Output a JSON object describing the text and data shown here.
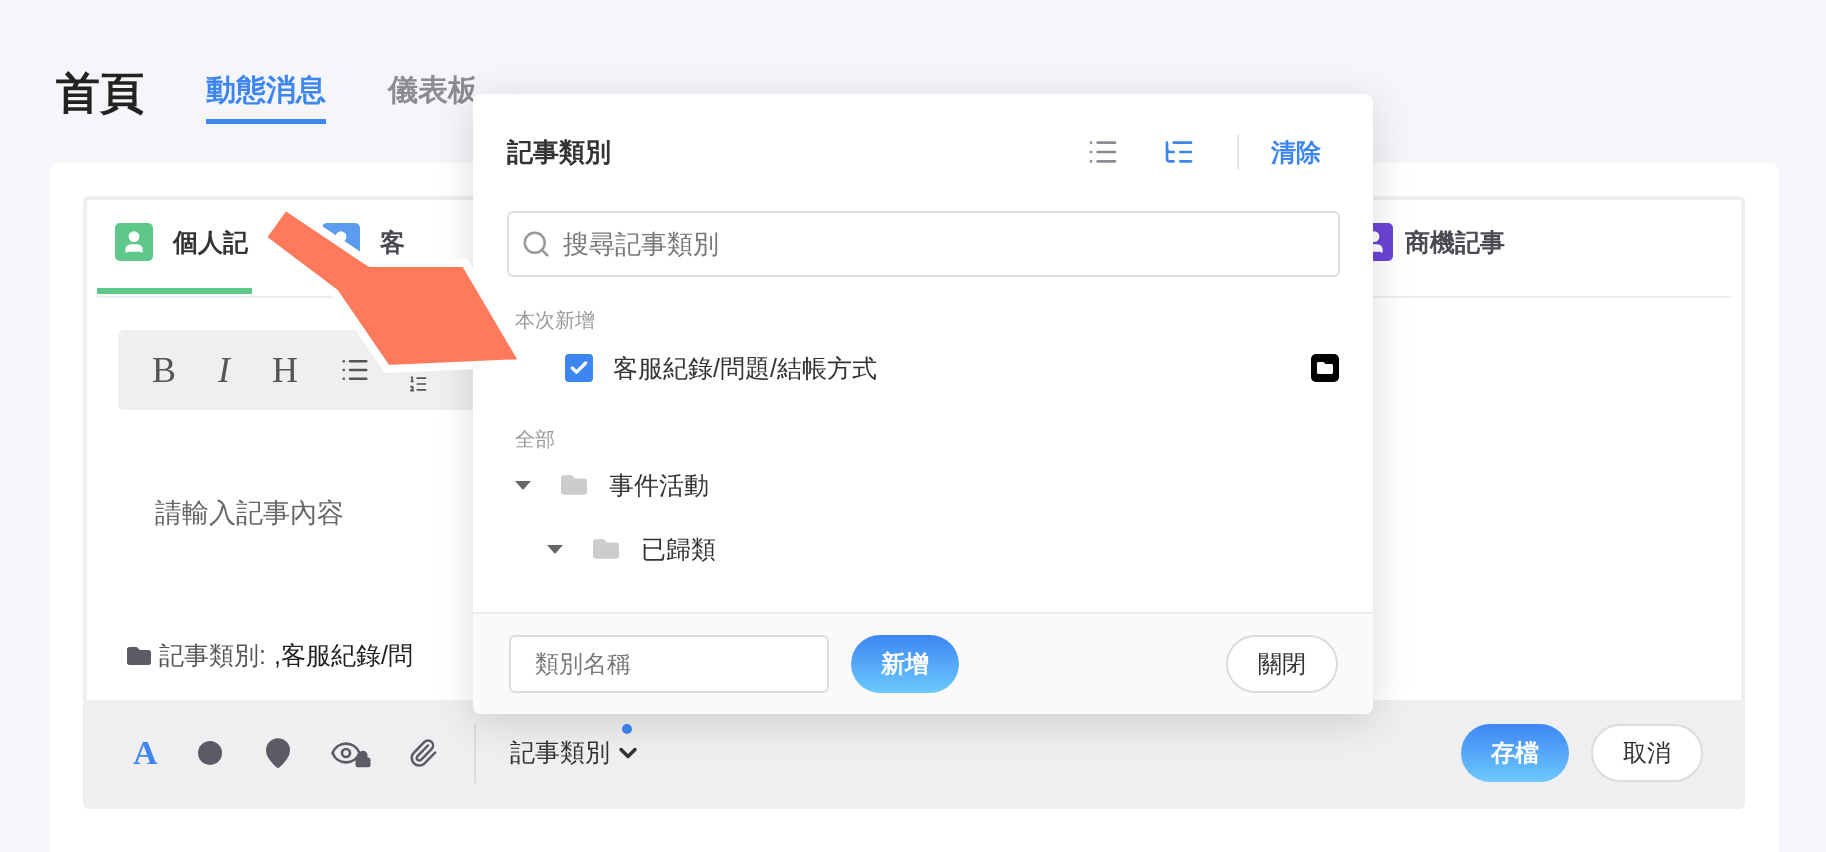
{
  "page": {
    "title": "首頁"
  },
  "nav_tabs": [
    {
      "label": "動態消息",
      "selected": true
    },
    {
      "label": "儀表板",
      "selected": false
    }
  ],
  "note_tabs": [
    {
      "label": "個人記",
      "color": "#5ec78a",
      "selected": true
    },
    {
      "label": "客",
      "color": "#5b9cf0",
      "selected": false
    },
    {
      "label": "商機記事",
      "color": "#6b45d6",
      "selected": false
    }
  ],
  "format_toolbar": [
    "B",
    "I",
    "H"
  ],
  "editor": {
    "placeholder": "請輸入記事內容",
    "category_label": "記事類別:",
    "category_value": ",客服紀錄/問"
  },
  "bottom_bar": {
    "font_color": "A",
    "category_button": "記事類別",
    "has_update": true,
    "buttons": [
      {
        "label": "存檔",
        "kind": "primary"
      },
      {
        "label": "取消",
        "kind": "secondary"
      }
    ]
  },
  "popup": {
    "title": "記事類別",
    "view_modes": [
      {
        "kind": "list",
        "selected": false
      },
      {
        "kind": "tree",
        "selected": true
      }
    ],
    "clear": "清除",
    "search": {
      "placeholder": "搜尋記事類別"
    },
    "recent": {
      "heading": "本次新增",
      "items": [
        {
          "label": "客服紀錄/問題/結帳方式",
          "checked": true
        }
      ]
    },
    "all": {
      "heading": "全部",
      "tree": [
        {
          "label": "事件活動",
          "expanded": true,
          "children": [
            {
              "label": "已歸類",
              "expanded": true
            }
          ]
        }
      ]
    },
    "footer": {
      "name_field": {
        "placeholder": "類別名稱"
      },
      "add": "新增",
      "close": "關閉"
    }
  }
}
